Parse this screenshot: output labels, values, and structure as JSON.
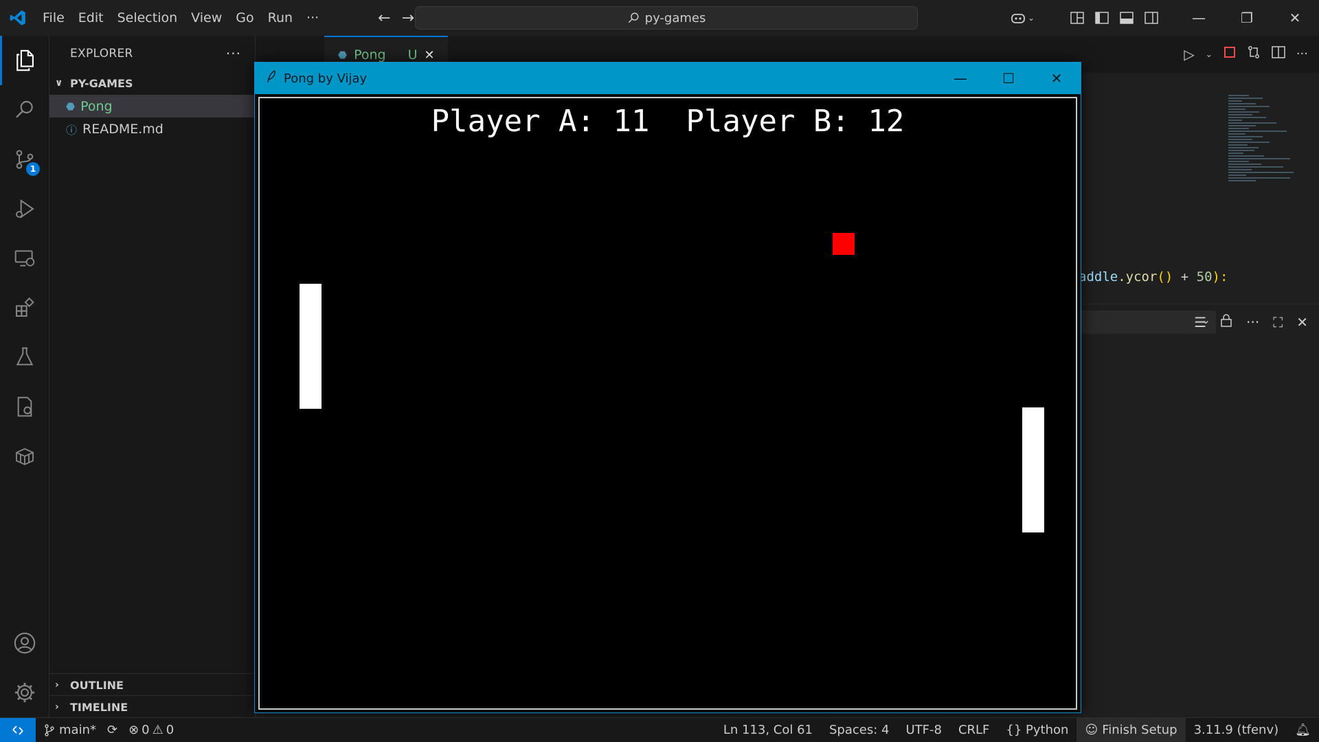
{
  "menu": [
    "File",
    "Edit",
    "Selection",
    "View",
    "Go",
    "Run",
    "···"
  ],
  "search": {
    "text": "py-games"
  },
  "explorer": {
    "title": "EXPLORER",
    "more": "···",
    "folder": "PY-GAMES",
    "files": [
      {
        "name": "Pong",
        "icon": "python-icon"
      },
      {
        "name": "README.md",
        "icon": "info-icon"
      }
    ],
    "outline": "OUTLINE",
    "timeline": "TIMELINE"
  },
  "activity": {
    "source_control_badge": "1"
  },
  "tab": {
    "label": "Pong",
    "status": "U"
  },
  "editor": {
    "code_var": "addle",
    "code_func": ".ycor",
    "code_open": "()",
    "code_op": " + ",
    "code_num": "50",
    "code_close": "):"
  },
  "pong_window": {
    "title": "Pong by Vijay",
    "score_text": "Player A: 11  Player B: 12",
    "score_a": 11,
    "score_b": 12,
    "colors": {
      "background": "#000000",
      "paddle": "#ffffff",
      "ball": "#ff0000"
    }
  },
  "statusbar": {
    "branch": "main*",
    "errors": "0",
    "warnings": "0",
    "cursor": "Ln 113, Col 61",
    "spaces": "Spaces: 4",
    "encoding": "UTF-8",
    "eol": "CRLF",
    "language": "Python",
    "finish_setup": "Finish Setup",
    "interpreter": "3.11.9 (tfenv)"
  },
  "accent_color": "#0078d4"
}
